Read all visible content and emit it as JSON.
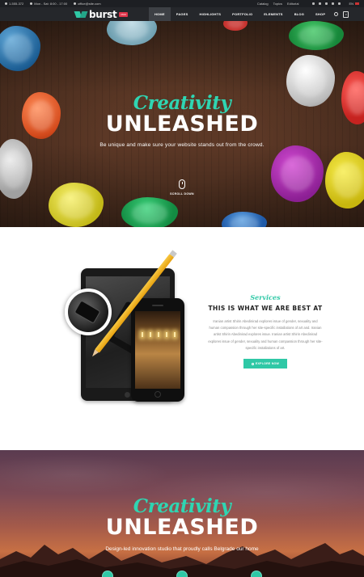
{
  "topbar": {
    "phone": "1-555-372",
    "hours": "Mon - Sat: 8:00 - 17:00",
    "email": "office@site.com",
    "links": [
      "Catalog",
      "Topics",
      "Editorial"
    ],
    "social_icons": [
      "facebook-icon",
      "twitter-icon",
      "pinterest-icon",
      "instagram-icon",
      "linkedin-icon"
    ],
    "language": "EN"
  },
  "nav": {
    "logo": "burst",
    "logo_badge": "PRO",
    "items": [
      {
        "label": "HOME",
        "active": true
      },
      {
        "label": "PAGES",
        "active": false
      },
      {
        "label": "HIGHLIGHTS",
        "active": false
      },
      {
        "label": "PORTFOLIO",
        "active": false
      },
      {
        "label": "ELEMENTS",
        "active": false
      },
      {
        "label": "BLOG",
        "active": false
      },
      {
        "label": "SHOP",
        "active": false
      }
    ],
    "cart_count": "0"
  },
  "hero": {
    "script": "Creativity",
    "title": "UNLEASHED",
    "subtitle": "Be unique and make sure your website stands out from the crowd.",
    "scroll_label": "SCROLL DOWN"
  },
  "services": {
    "script": "Services",
    "title": "THIS IS WHAT WE ARE BEST AT",
    "body": "Iranian artist Shirin Abedinirad explores issue of gender, sexuality and human compassion through her site-specific installations of art and. Iranian artist Shirin Abedinirad explores issue. Iranian artist Shirin Abedinirad explores issue of gender, sexuality and human compassion through her site-specific installations of art.",
    "button": "EXPLORE NOW"
  },
  "hero2": {
    "script": "Creativity",
    "title": "UNLEASHED",
    "subtitle": "Design-led innovation studio that proudly calls Belgrade our home"
  },
  "colors": {
    "accent": "#2fc8a6",
    "topbar": "#1d1f23",
    "nav": "#25272b",
    "badge": "#e0344a"
  }
}
